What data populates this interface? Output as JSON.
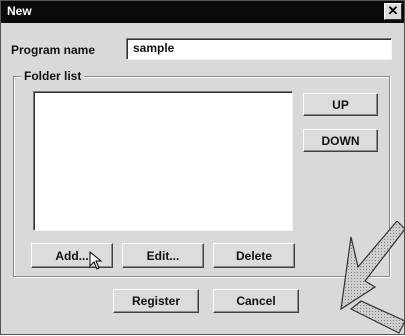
{
  "window": {
    "title": "New",
    "close_glyph": "✕"
  },
  "program": {
    "label": "Program name",
    "value": "sample"
  },
  "folder_list": {
    "label": "Folder list",
    "items": []
  },
  "buttons": {
    "up": "UP",
    "down": "DOWN",
    "add": "Add...",
    "edit": "Edit...",
    "delete": "Delete",
    "register": "Register",
    "cancel": "Cancel"
  },
  "icons": {
    "cursor": "mouse-pointer-icon",
    "callout": "callout-arrow-icon"
  },
  "colors": {
    "titlebar": "#0a0a0a",
    "dialog_bg": "#d9d9d9",
    "arrow_fill": "#bdbdbd"
  }
}
